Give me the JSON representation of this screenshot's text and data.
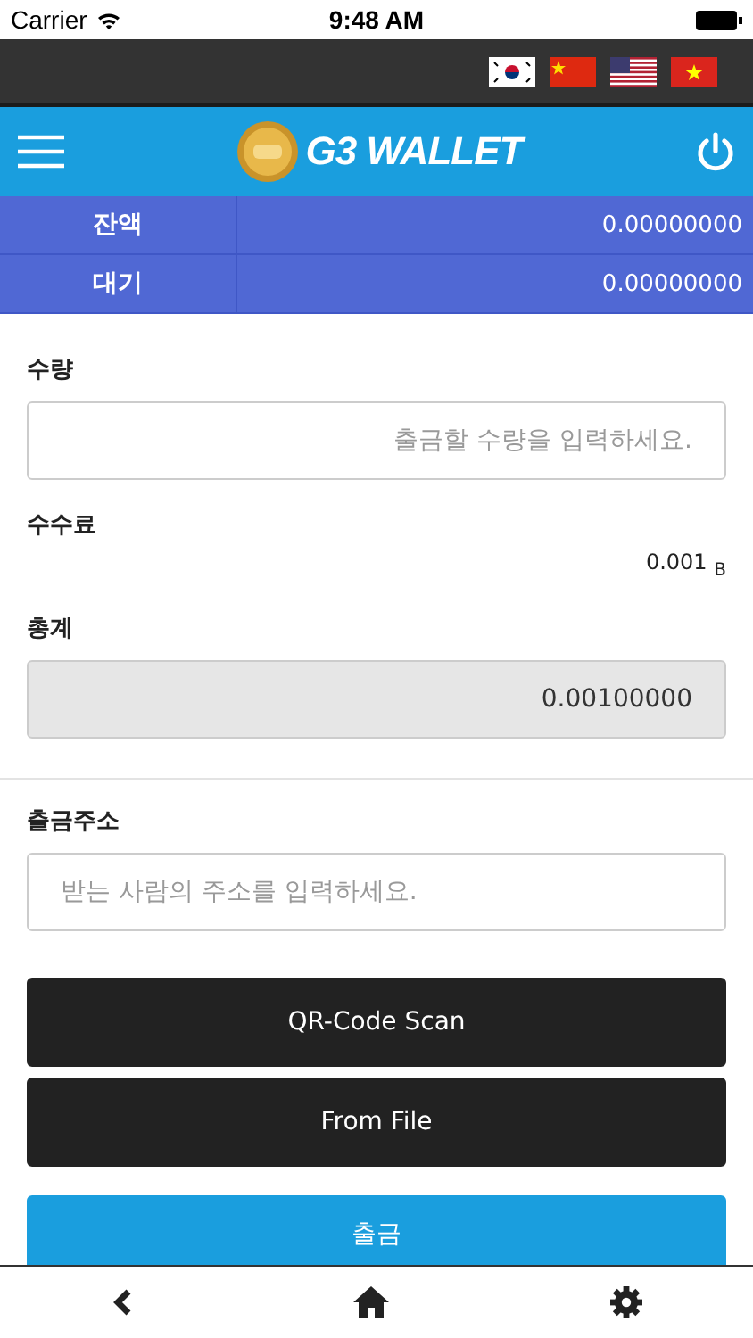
{
  "status_bar": {
    "carrier": "Carrier",
    "time": "9:48 AM"
  },
  "header": {
    "title": "G3 WALLET"
  },
  "balances": [
    {
      "label": "잔액",
      "value": "0.00000000"
    },
    {
      "label": "대기",
      "value": "0.00000000"
    }
  ],
  "form": {
    "amount": {
      "label": "수량",
      "placeholder": "출금할 수량을 입력하세요."
    },
    "fee": {
      "label": "수수료",
      "value": "0.001 $_{B}$"
    },
    "total": {
      "label": "총계",
      "value": "0.00100000"
    },
    "address": {
      "label": "출금주소",
      "placeholder": "받는 사람의 주소를 입력하세요."
    }
  },
  "buttons": [
    {
      "kind": "dark",
      "label": "QR-Code Scan"
    },
    {
      "kind": "dark",
      "label": "From File"
    },
    {
      "kind": "primary",
      "label": "출금"
    }
  ]
}
